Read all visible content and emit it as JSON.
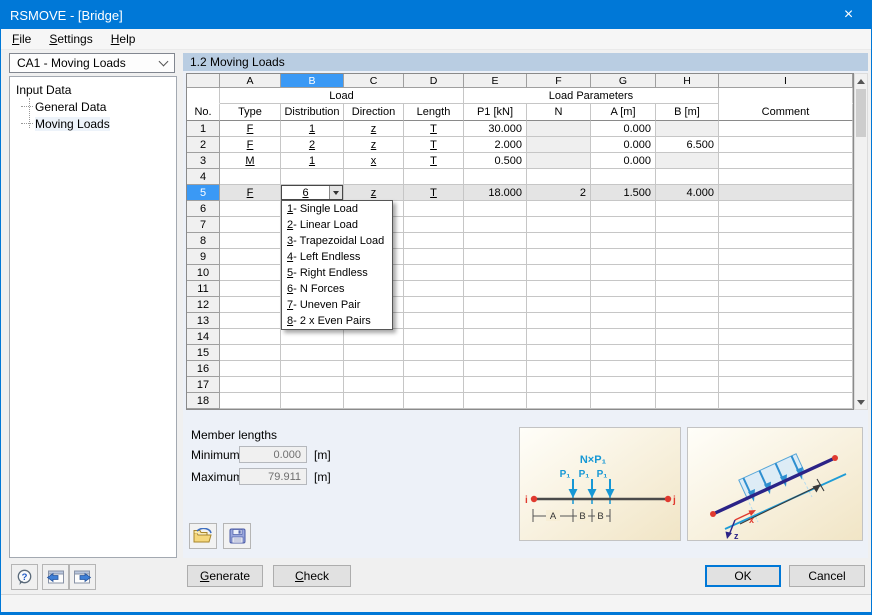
{
  "window": {
    "title": "RSMOVE - [Bridge]",
    "close_glyph": "×"
  },
  "menu": {
    "items": [
      {
        "key": "F",
        "rest": "ile"
      },
      {
        "key": "S",
        "rest": "ettings"
      },
      {
        "key": "H",
        "rest": "elp"
      }
    ]
  },
  "sidebar": {
    "case_selector": "CA1 - Moving Loads",
    "tree": {
      "root": "Input Data",
      "items": [
        "General Data",
        "Moving Loads"
      ],
      "selected": "Moving Loads"
    }
  },
  "main": {
    "section_title": "1.2 Moving Loads",
    "table": {
      "letters": [
        "A",
        "B",
        "C",
        "D",
        "E",
        "F",
        "G",
        "H",
        "I"
      ],
      "selected_letter": "B",
      "groups": {
        "load": "Load",
        "params": "Load Parameters"
      },
      "headers": {
        "no": "No.",
        "type": "Type",
        "dist": "Distribution",
        "dir": "Direction",
        "len": "Length",
        "p1": "P1 [kN]",
        "n": "N",
        "a": "A [m]",
        "b": "B [m]",
        "comment": "Comment"
      },
      "rows": [
        {
          "no": "1",
          "type": "F",
          "dist": "1",
          "dir": "z",
          "len": "T",
          "p1": "30.000",
          "n": "",
          "a": "0.000",
          "b": "",
          "comment": "",
          "disabled": [
            "n",
            "b"
          ]
        },
        {
          "no": "2",
          "type": "F",
          "dist": "2",
          "dir": "z",
          "len": "T",
          "p1": "2.000",
          "n": "",
          "a": "0.000",
          "b": "6.500",
          "comment": "",
          "disabled": [
            "n"
          ]
        },
        {
          "no": "3",
          "type": "M",
          "dist": "1",
          "dir": "x",
          "len": "T",
          "p1": "0.500",
          "n": "",
          "a": "0.000",
          "b": "",
          "comment": "",
          "disabled": [
            "n",
            "b"
          ]
        },
        {
          "no": "4"
        },
        {
          "no": "5",
          "selected": true,
          "combo_open": true,
          "type": "F",
          "dist": "6",
          "dir": "z",
          "len": "T",
          "p1": "18.000",
          "n": "2",
          "a": "1.500",
          "b": "4.000",
          "comment": ""
        },
        {
          "no": "6"
        },
        {
          "no": "7"
        },
        {
          "no": "8"
        },
        {
          "no": "9"
        },
        {
          "no": "10"
        },
        {
          "no": "11"
        },
        {
          "no": "12"
        },
        {
          "no": "13"
        },
        {
          "no": "14"
        },
        {
          "no": "15"
        },
        {
          "no": "16"
        },
        {
          "no": "17"
        },
        {
          "no": "18"
        }
      ]
    },
    "distribution_dropdown": {
      "value": "6",
      "items": [
        {
          "num": "1",
          "label": "Single Load"
        },
        {
          "num": "2",
          "label": "Linear Load"
        },
        {
          "num": "3",
          "label": "Trapezoidal Load"
        },
        {
          "num": "4",
          "label": "Left Endless"
        },
        {
          "num": "5",
          "label": "Right Endless"
        },
        {
          "num": "6",
          "label": "N Forces"
        },
        {
          "num": "7",
          "label": "Uneven Pair"
        },
        {
          "num": "8",
          "label": "2 x Even Pairs"
        }
      ]
    },
    "member_lengths": {
      "title": "Member lengths",
      "minimum_label": "Minimum:",
      "minimum_value": "0.000",
      "maximum_label": "Maximum:",
      "maximum_value": "79.911",
      "unit": "[m]"
    },
    "beam_diagram": {
      "top_label": "N×P₁",
      "force_label": "P₁",
      "node_i": "i",
      "node_j": "j",
      "dim_a": "A",
      "dim_b": "B"
    },
    "iso_diagram": {
      "x_label": "x",
      "z_label": "z"
    }
  },
  "footer": {
    "generate": {
      "key": "G",
      "rest": "enerate"
    },
    "check": {
      "key": "C",
      "rest": "heck"
    },
    "ok": "OK",
    "cancel": "Cancel"
  },
  "colors": {
    "titlebar": "#0078d7",
    "section_header": "#b9cde2",
    "selection_blue": "#3a99f5",
    "arrow_blue": "#1798d5"
  }
}
